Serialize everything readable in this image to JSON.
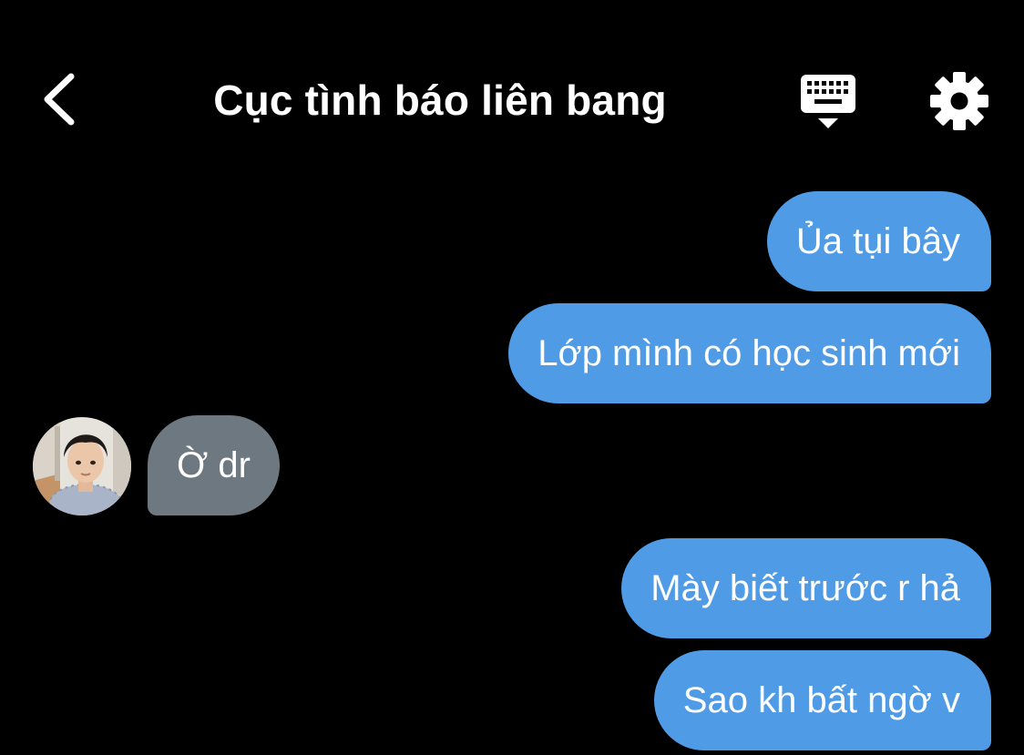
{
  "header": {
    "title": "Cục tình báo liên bang",
    "back_icon": "chevron-left-icon",
    "keyboard_icon": "keyboard-icon",
    "settings_icon": "gear-icon"
  },
  "messages": [
    {
      "direction": "sent",
      "text": "Ủa tụi bây"
    },
    {
      "direction": "sent",
      "text": "Lớp mình có học sinh mới"
    },
    {
      "direction": "received",
      "text": "Ờ dr"
    },
    {
      "direction": "sent",
      "text": "Mày biết trước r hả"
    },
    {
      "direction": "sent",
      "text": "Sao kh bất ngờ v"
    }
  ],
  "colors": {
    "background": "#000000",
    "sent_bubble": "#4f9be6",
    "received_bubble": "#6e7880",
    "text": "#ffffff"
  }
}
